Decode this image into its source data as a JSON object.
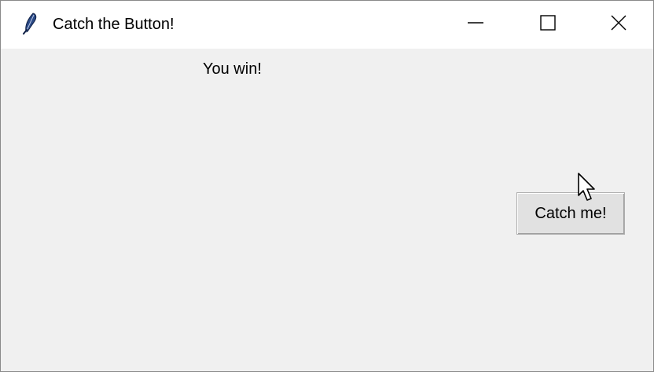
{
  "window": {
    "title": "Catch the Button!",
    "app_icon": "feather-icon",
    "controls": {
      "minimize_icon": "minimize-icon",
      "maximize_icon": "maximize-icon",
      "close_icon": "close-icon"
    }
  },
  "content": {
    "status_text": "You win!",
    "button_label": "Catch me!"
  },
  "cursor": {
    "icon": "arrow-cursor-icon"
  },
  "colors": {
    "background": "#f0f0f0",
    "titlebar": "#ffffff",
    "button_face": "#e1e1e1",
    "button_border": "#adadad",
    "text": "#000000"
  }
}
